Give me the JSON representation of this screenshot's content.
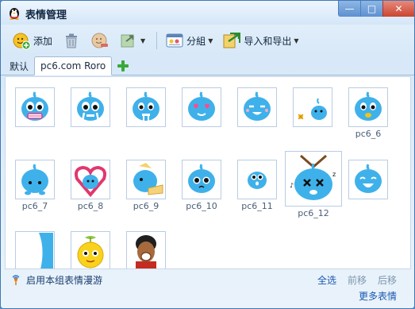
{
  "window": {
    "title": "表情管理",
    "min_glyph": "—",
    "max_glyph": "□",
    "close_glyph": "✕"
  },
  "toolbar": {
    "add_label": "添加",
    "group_label": "分組",
    "import_export_label": "导入和导出",
    "caret": "▼"
  },
  "tabs": {
    "items": [
      "默认",
      "pc6.com Roro"
    ],
    "active_index": 1,
    "add_glyph": "+"
  },
  "grid": {
    "labels": {
      "c6": "pc6_6",
      "c7": "pc6_7",
      "c8": "pc6_8",
      "c9": "pc6_9",
      "c10": "pc6_10",
      "c11": "pc6_11",
      "c12": "pc6_12"
    }
  },
  "footer": {
    "roam_label": "启用本组表情漫游",
    "select_all": "全选",
    "move_up": "前移",
    "move_down": "后移",
    "more": "更多表情"
  },
  "colors": {
    "accent": "#3fb1ea",
    "link": "#1a58b0",
    "border": "#9fbad6"
  }
}
